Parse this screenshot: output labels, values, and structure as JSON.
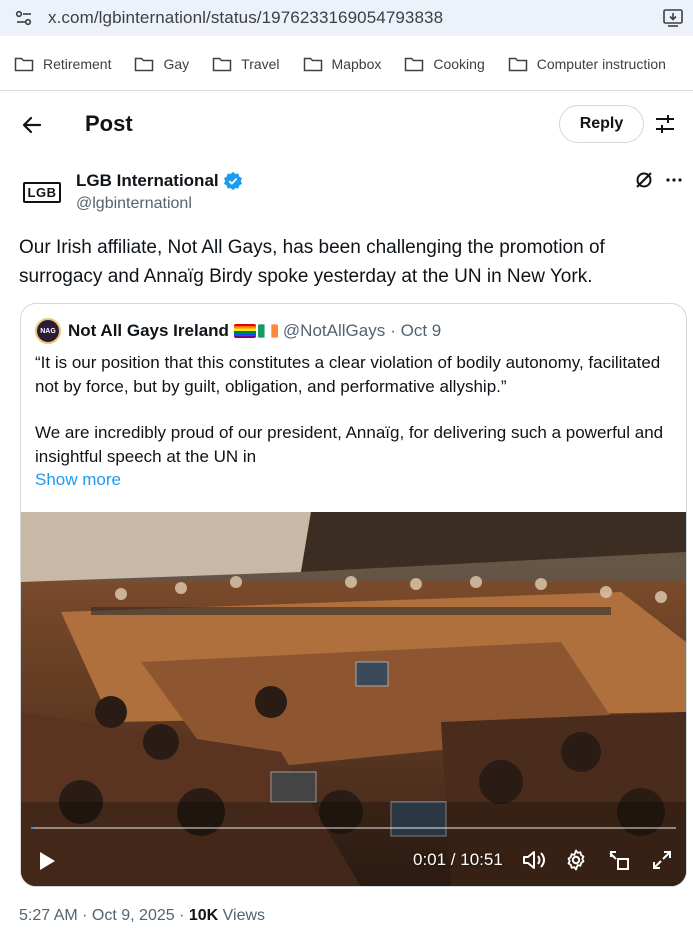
{
  "browser": {
    "url": "x.com/lgbinternationl/status/1976233169054793838",
    "bookmarks": [
      "Retirement",
      "Gay",
      "Travel",
      "Mapbox",
      "Cooking",
      "Computer instruction"
    ]
  },
  "header": {
    "title": "Post",
    "reply_label": "Reply"
  },
  "author": {
    "avatar_text": "LGB",
    "name": "LGB International",
    "handle": "@lgbinternationl"
  },
  "post": {
    "text": "Our Irish affiliate, Not All Gays, has been challenging the promotion of surrogacy and Annaïg Birdy spoke yesterday at the UN in New York."
  },
  "quote": {
    "avatar_text": "NAG",
    "name": "Not All Gays Ireland",
    "handle": "@NotAllGays",
    "date": "· Oct 9",
    "paragraph1": "“It is our position that this constitutes a clear violation of bodily  autonomy, facilitated not by force, but by guilt, obligation, and performative allyship.”",
    "paragraph2": "We are incredibly proud of our president, Annaïg, for delivering such a powerful and insightful speech at the UN in",
    "show_more": "Show more",
    "video": {
      "time": "0:01 / 10:51",
      "progress": 0.0015
    }
  },
  "meta": {
    "timestamp": "5:27 AM · Oct 9, 2025 · ",
    "views_count": "10K",
    "views_label": " Views"
  },
  "colors": {
    "accent": "#1d9bf0",
    "secondary_text": "#536471",
    "border": "#cfd9de"
  }
}
